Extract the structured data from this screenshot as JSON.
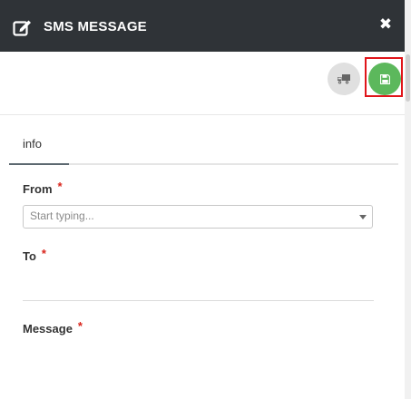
{
  "header": {
    "title": "SMS MESSAGE",
    "close_symbol": "✖",
    "title_icon": "edit-icon",
    "background": "#2f3337"
  },
  "toolbar": {
    "aux_button_icon": "truck-icon",
    "save_button_icon": "floppy-disk-icon",
    "save_color": "#5cb85c",
    "highlight_color": "#e0151a"
  },
  "tabs": [
    {
      "label": "info",
      "active": true
    }
  ],
  "form": {
    "from": {
      "label": "From",
      "required_mark": "*",
      "placeholder": "Start typing...",
      "value": ""
    },
    "to": {
      "label": "To",
      "required_mark": "*",
      "value": ""
    },
    "message": {
      "label": "Message",
      "required_mark": "*",
      "value": ""
    }
  }
}
